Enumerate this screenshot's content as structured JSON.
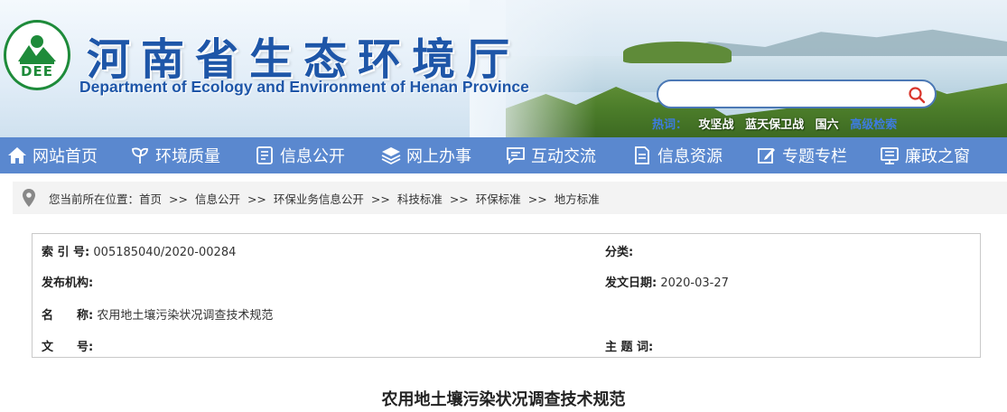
{
  "header": {
    "title_cn": "河南省生态环境厅",
    "title_en": "Department of Ecology and Environment of Henan Province",
    "logo_text": "DEE",
    "search": {
      "placeholder": ""
    },
    "hotwords_label": "热词：",
    "hotwords": [
      "攻坚战",
      "蓝天保卫战",
      "国六",
      "高级检索"
    ]
  },
  "nav": {
    "items": [
      {
        "label": "网站首页",
        "icon": "home-icon"
      },
      {
        "label": "环境质量",
        "icon": "leaf-icon"
      },
      {
        "label": "信息公开",
        "icon": "document-icon"
      },
      {
        "label": "网上办事",
        "icon": "layers-icon"
      },
      {
        "label": "互动交流",
        "icon": "chat-icon"
      },
      {
        "label": "信息资源",
        "icon": "file-icon"
      },
      {
        "label": "专题专栏",
        "icon": "edit-icon"
      },
      {
        "label": "廉政之窗",
        "icon": "monitor-icon"
      }
    ]
  },
  "breadcrumb": {
    "prefix": "您当前所在位置：",
    "items": [
      "首页",
      "信息公开",
      "环保业务信息公开",
      "科技标准",
      "环保标准",
      "地方标准"
    ],
    "separator": ">>"
  },
  "meta": {
    "index_label": "索 引 号:",
    "index_value": "005185040/2020-00284",
    "category_label": "分类:",
    "category_value": "",
    "publisher_label": "发布机构:",
    "publisher_value": "",
    "date_label": "发文日期:",
    "date_value": "2020-03-27",
    "name_label": "名　　称:",
    "name_value": "农用地土壤污染状况调查技术规范",
    "docno_label": "文　　号:",
    "docno_value": "",
    "subject_label": "主 题 词:",
    "subject_value": ""
  },
  "article": {
    "title": "农用地土壤污染状况调查技术规范"
  },
  "colors": {
    "nav_bg": "#5a88cf",
    "title_blue": "#1e56a8",
    "logo_green": "#1e8b3a",
    "search_icon_red": "#d9352b"
  }
}
